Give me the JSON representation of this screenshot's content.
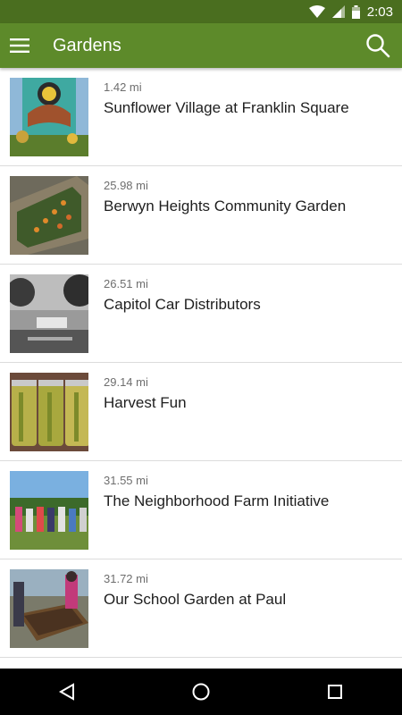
{
  "status_bar": {
    "time": "2:03",
    "icons": [
      "wifi-icon",
      "signal-icon",
      "battery-icon"
    ]
  },
  "app_bar": {
    "title": "Gardens",
    "menu_icon": "hamburger-menu-icon",
    "search_icon": "search-icon"
  },
  "colors": {
    "status_bar": "#4a6e1f",
    "app_bar": "#5d8a2a",
    "nav_bar": "#000000"
  },
  "gardens": [
    {
      "distance": "1.42 mi",
      "name": "Sunflower Village at Franklin Square"
    },
    {
      "distance": "25.98 mi",
      "name": "Berwyn Heights Community Garden"
    },
    {
      "distance": "26.51 mi",
      "name": "Capitol Car Distributors"
    },
    {
      "distance": "29.14 mi",
      "name": "Harvest Fun"
    },
    {
      "distance": "31.55 mi",
      "name": "The Neighborhood Farm Initiative"
    },
    {
      "distance": "31.72 mi",
      "name": "Our School Garden at Paul"
    }
  ],
  "nav_bar": {
    "icons": [
      "back-icon",
      "home-icon",
      "recents-icon"
    ]
  }
}
